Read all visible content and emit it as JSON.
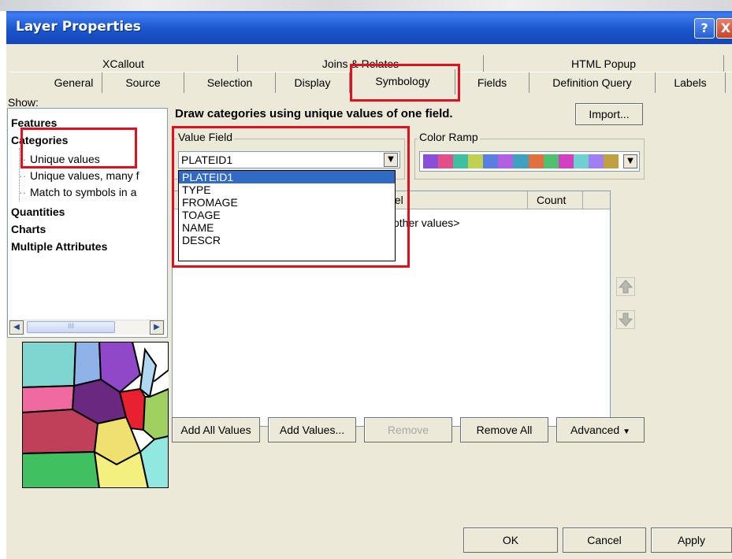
{
  "window": {
    "title": "Layer Properties",
    "help": "?",
    "close": "X"
  },
  "tabs_row1": [
    "XCallout",
    "Joins & Relates",
    "HTML Popup"
  ],
  "tabs_row2": [
    "General",
    "Source",
    "Selection",
    "Display",
    "Symbology",
    "Fields",
    "Definition Query",
    "Labels"
  ],
  "active_tab": "Symbology",
  "show": {
    "label": "Show:",
    "items": [
      {
        "label": "Features",
        "bold": true
      },
      {
        "label": "Categories",
        "bold": true
      },
      {
        "label": "Unique values",
        "bold": false
      },
      {
        "label": "Unique values, many f",
        "bold": false
      },
      {
        "label": "Match to symbols in a",
        "bold": false
      },
      {
        "label": "Quantities",
        "bold": true
      },
      {
        "label": "Charts",
        "bold": true
      },
      {
        "label": "Multiple Attributes",
        "bold": true
      }
    ],
    "selected": "Unique values",
    "scroll_thumb": "III"
  },
  "main": {
    "heading": "Draw categories using unique values of one field.",
    "import_button": "Import...",
    "value_field": {
      "label": "Value Field",
      "selected": "PLATEID1",
      "options": [
        "PLATEID1",
        "TYPE",
        "FROMAGE",
        "TOAGE",
        "NAME",
        "DESCR"
      ]
    },
    "color_ramp": {
      "label": "Color Ramp",
      "colors": [
        "#8a4fd8",
        "#e0508a",
        "#3fbf9f",
        "#c0d050",
        "#5a7fe0",
        "#b060e0",
        "#40a0c0",
        "#e07040",
        "#50c070",
        "#d040c0",
        "#70d0d0",
        "#a080f0",
        "#c0a040"
      ]
    },
    "table": {
      "headers": [
        "Label",
        "Count"
      ],
      "visible_header": "bel",
      "rows": [
        [
          "<all other values>",
          ""
        ]
      ],
      "visible_row": "other values>"
    },
    "move_up_icon": "up-arrow",
    "move_down_icon": "down-arrow"
  },
  "buttons": {
    "add_all": "Add All Values",
    "add_values": "Add Values...",
    "remove": "Remove",
    "remove_all": "Remove All",
    "advanced": "Advanced"
  },
  "footer": {
    "ok": "OK",
    "cancel": "Cancel",
    "apply": "Apply"
  },
  "colors": {
    "title_bar": "#1f5bd0",
    "dialog_bg": "#ece9d8",
    "highlight": "#316ac5",
    "annotation_red": "#e0101e"
  }
}
